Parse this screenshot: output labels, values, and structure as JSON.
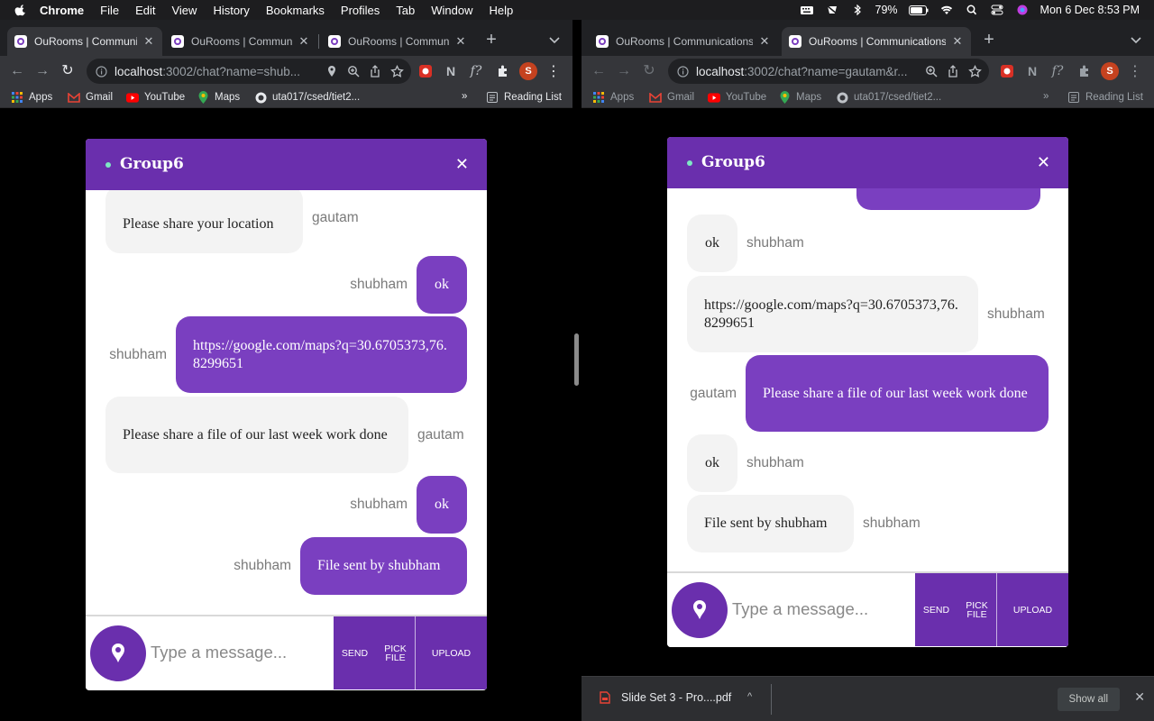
{
  "menubar": {
    "app": "Chrome",
    "items": [
      "File",
      "Edit",
      "View",
      "History",
      "Bookmarks",
      "Profiles",
      "Tab",
      "Window",
      "Help"
    ],
    "battery": "79%",
    "datetime": "Mon 6 Dec  8:53 PM"
  },
  "left": {
    "tabs": [
      {
        "title": "OuRooms | Communica"
      },
      {
        "title": "OuRooms | Communica"
      },
      {
        "title": "OuRooms | Communica"
      }
    ],
    "url_host": "localhost",
    "url_path": ":3002/chat?name=shub...",
    "bookmarks": [
      "Apps",
      "Gmail",
      "YouTube",
      "Maps",
      "uta017/csed/tiet2..."
    ],
    "reading_list": "Reading List",
    "chat": {
      "room": "Group6",
      "messages": [
        {
          "text": "Please share your location",
          "sender": "gautam",
          "mine": false
        },
        {
          "text": "ok",
          "sender": "shubham",
          "mine": true
        },
        {
          "text": "https://google.com/maps?q=30.6705373,76.8299651",
          "sender": "shubham",
          "mine": true
        },
        {
          "text": "Please share a file of our last week work done",
          "sender": "gautam",
          "mine": false
        },
        {
          "text": "ok",
          "sender": "shubham",
          "mine": true
        },
        {
          "text": "File sent by shubham",
          "sender": "shubham",
          "mine": true
        }
      ],
      "placeholder": "Type a message...",
      "send": "SEND",
      "pick_file": "PICK FILE",
      "upload": "UPLOAD"
    }
  },
  "right": {
    "tabs": [
      {
        "title": "OuRooms | Communications"
      },
      {
        "title": "OuRooms | Communications"
      }
    ],
    "url_host": "localhost",
    "url_path": ":3002/chat?name=gautam&r...",
    "bookmarks": [
      "Apps",
      "Gmail",
      "YouTube",
      "Maps",
      "uta017/csed/tiet2..."
    ],
    "reading_list": "Reading List",
    "chat": {
      "room": "Group6",
      "messages": [
        {
          "text": "ok",
          "sender": "shubham",
          "mine": false
        },
        {
          "text": "https://google.com/maps?q=30.6705373,76.8299651",
          "sender": "shubham",
          "mine": false
        },
        {
          "text": "Please share a file of our last week work done",
          "sender": "gautam",
          "mine": true
        },
        {
          "text": "ok",
          "sender": "shubham",
          "mine": false
        },
        {
          "text": "File sent by shubham",
          "sender": "shubham",
          "mine": false
        }
      ],
      "placeholder": "Type a message...",
      "send": "SEND",
      "pick_file": "PICK FILE",
      "upload": "UPLOAD"
    },
    "download": {
      "filename": "Slide Set 3 - Pro....pdf",
      "show_all": "Show all"
    }
  },
  "colors": {
    "accent": "#6a2fad",
    "bubble_out": "#7a3fc0",
    "bubble_in": "#f3f3f3"
  }
}
